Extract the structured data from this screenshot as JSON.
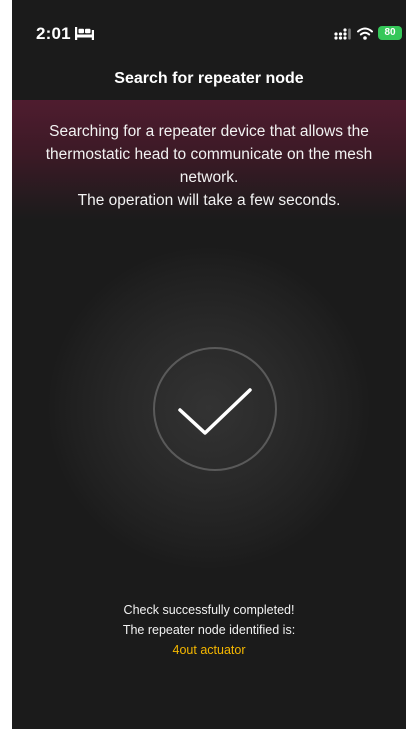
{
  "status_bar": {
    "time": "2:01",
    "battery": "80"
  },
  "header": {
    "title": "Search for repeater node"
  },
  "banner": {
    "line1": "Searching for a repeater device that allows the thermostatic head to communicate on the mesh network.",
    "line2": "The operation will take a few seconds."
  },
  "result": {
    "line1": "Check successfully completed!",
    "line2": "The repeater node identified is:",
    "node": "4out actuator"
  },
  "colors": {
    "background": "#1b1b1b",
    "banner": "#4f1c2f",
    "accent": "#f5b700",
    "battery": "#35c759"
  },
  "icons": [
    "bed-icon",
    "signal-icon",
    "wifi-icon",
    "checkmark-icon"
  ]
}
